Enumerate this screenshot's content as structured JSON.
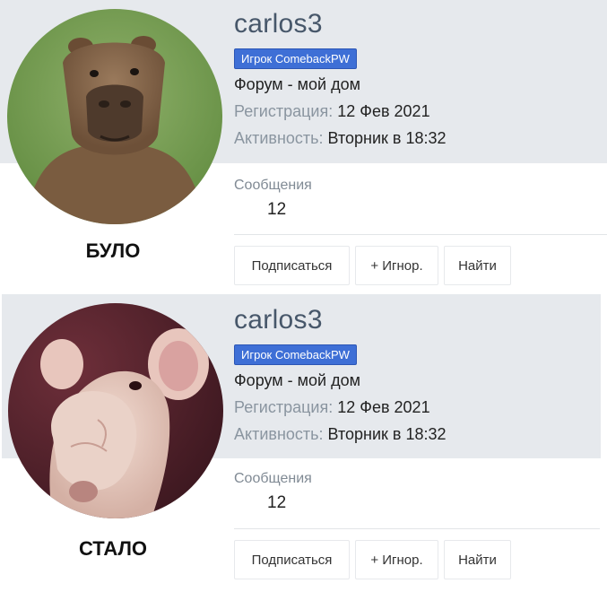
{
  "cards": [
    {
      "username": "carlos3",
      "badge": "Игрок ComebackPW",
      "status": "Форум - мой дом",
      "registration_label": "Регистрация:",
      "registration_value": "12 Фев 2021",
      "activity_label": "Активность:",
      "activity_value": "Вторник в 18:32",
      "messages_label": "Сообщения",
      "messages_count": "12",
      "caption": "БУЛО",
      "avatar_icon": "capybara-photo",
      "buttons": {
        "subscribe": "Подписаться",
        "ignore": "+ Игнор.",
        "find": "Найти"
      }
    },
    {
      "username": "carlos3",
      "badge": "Игрок ComebackPW",
      "status": "Форум - мой дом",
      "registration_label": "Регистрация:",
      "registration_value": "12 Фев 2021",
      "activity_label": "Активность:",
      "activity_value": "Вторник в 18:32",
      "messages_label": "Сообщения",
      "messages_count": "12",
      "caption": "СТАЛО",
      "avatar_icon": "hairless-rat-photo",
      "buttons": {
        "subscribe": "Подписаться",
        "ignore": "+ Игнор.",
        "find": "Найти"
      }
    }
  ],
  "colors": {
    "header_band": "#e6e9ed",
    "badge": "#3e6fd6",
    "username": "#47576a"
  }
}
